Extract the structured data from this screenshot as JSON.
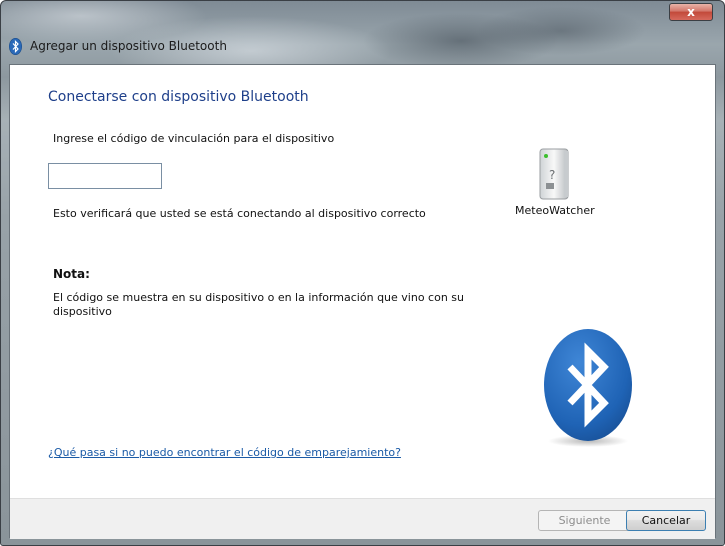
{
  "window": {
    "title": "Agregar un dispositivo Bluetooth",
    "close_label": "x"
  },
  "main": {
    "heading": "Conectarse con dispositivo Bluetooth",
    "prompt": "Ingrese el código de vinculación para el dispositivo",
    "code_input": {
      "value": "",
      "placeholder": ""
    },
    "verify_text": "Esto verificará que usted se está conectando al dispositivo correcto",
    "note_title": "Nota:",
    "note_body": "El código se muestra en su dispositivo o en la información que vino con su dispositivo",
    "help_link": "¿Qué pasa si no puedo encontrar el código de emparejamiento?"
  },
  "device": {
    "name": "MeteoWatcher",
    "icon": "device-unknown-icon"
  },
  "branding": {
    "icon": "bluetooth-logo",
    "color": "#1f63b5"
  },
  "footer": {
    "next_label": "Siguiente",
    "next_enabled": false,
    "cancel_label": "Cancelar"
  }
}
